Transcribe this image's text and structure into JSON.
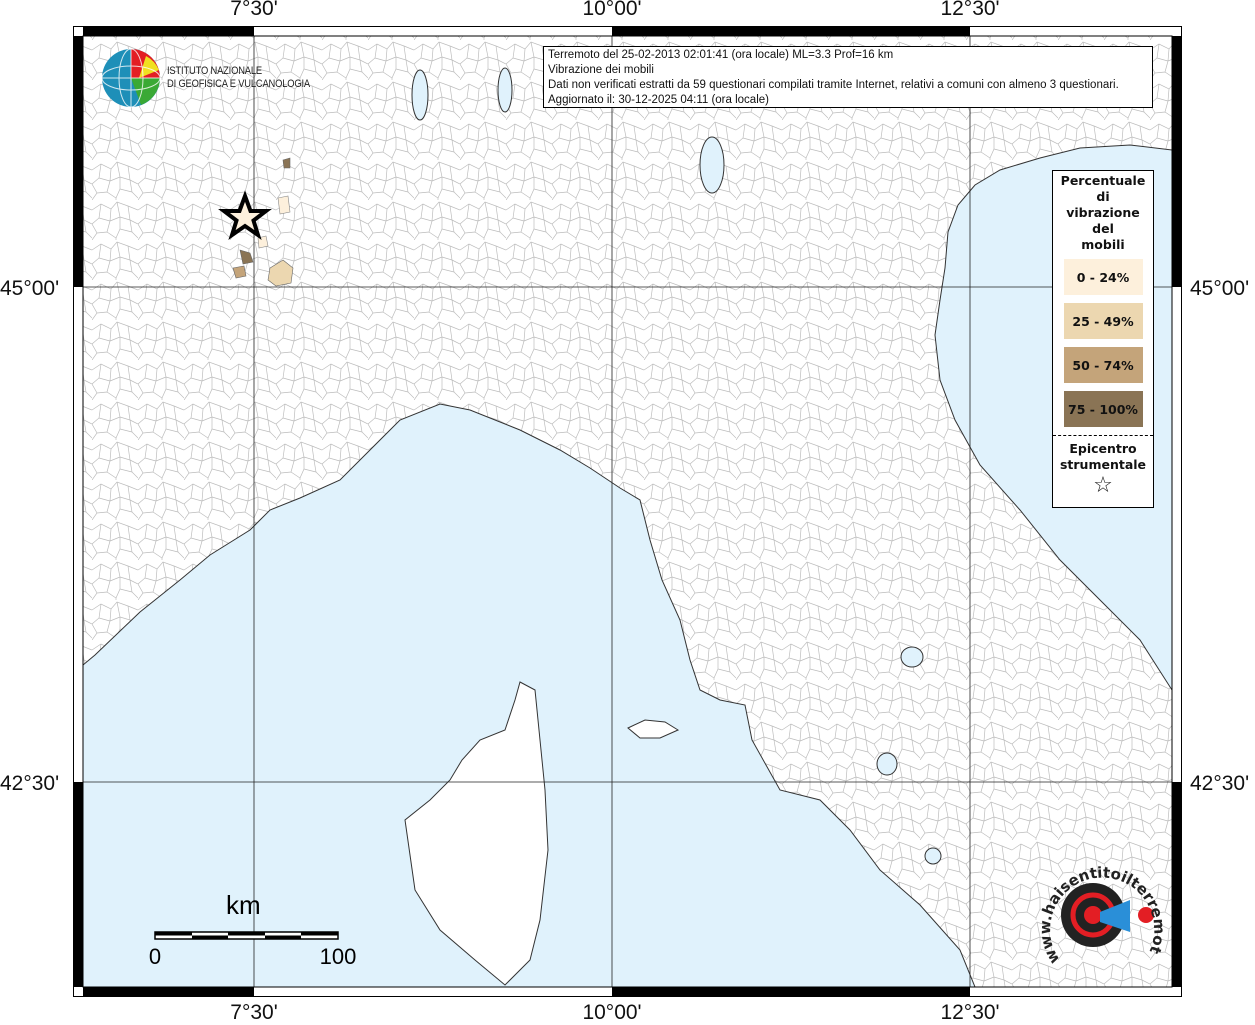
{
  "info": {
    "line1": "Terremoto del 25-02-2013 02:01:41 (ora locale) ML=3.3 Prof=16 km",
    "line2": "Vibrazione dei mobili",
    "line3": "Dati non verificati estratti da 59 questionari compilati tramite Internet, relativi a comuni con almeno 3 questionari.",
    "line4": "Aggiornato il: 30-12-2025 04:11 (ora locale)"
  },
  "logos": {
    "ingv_line1": "ISTITUTO NAZIONALE",
    "ingv_line2": "DI GEOFISICA E VULCANOLOGIA",
    "hsit": "www.haisentitoilterremoto.it"
  },
  "axes": {
    "lon_ticks": [
      "7°30'",
      "10°00'",
      "12°30'"
    ],
    "lat_ticks": [
      "45°00'",
      "42°30'"
    ]
  },
  "legend": {
    "title": "Percentuale\ndi\nvibrazione\ndel\nmobili",
    "classes": [
      {
        "label": "0 - 24%",
        "color": "#fdf0dc"
      },
      {
        "label": "25 - 49%",
        "color": "#ecd7b0"
      },
      {
        "label": "50 - 74%",
        "color": "#c4a47a"
      },
      {
        "label": "75 - 100%",
        "color": "#8a7455"
      }
    ],
    "epicenter_label": "Epicentro\nstrumentale",
    "epicenter_icon": "star-outline-icon"
  },
  "scale": {
    "unit": "km",
    "min": "0",
    "max": "100"
  },
  "colors": {
    "sea": "#e0f2fc",
    "land": "#ffffff",
    "boundaries": "#b8b8b8"
  }
}
